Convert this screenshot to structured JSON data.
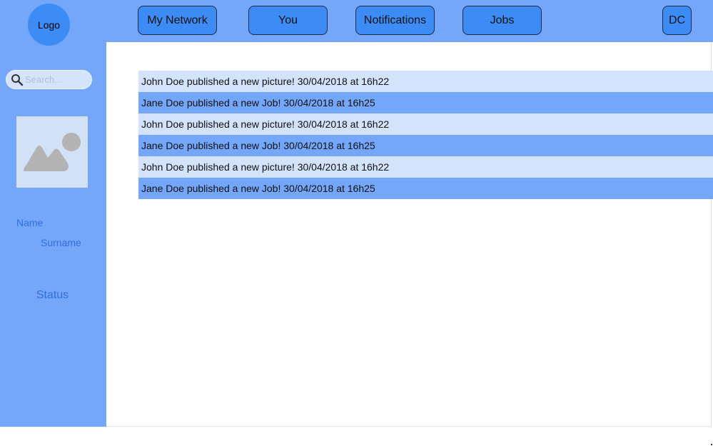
{
  "header": {
    "logo": "Logo",
    "nav": {
      "my_network": "My Network",
      "you": "You",
      "notifications": "Notifications",
      "jobs": "Jobs",
      "user_initials": "DC"
    }
  },
  "sidebar": {
    "search_placeholder": "Search...",
    "profile": {
      "name": "Name",
      "surname": "Surname",
      "status": "Status"
    }
  },
  "feed": {
    "items": [
      "John Doe published a new picture! 30/04/2018 at 16h22",
      "Jane Doe published a new Job! 30/04/2018 at 16h25",
      "John Doe published a new picture! 30/04/2018 at 16h22",
      "Jane Doe published a new Job! 30/04/2018 at 16h25",
      "John Doe published a new picture! 30/04/2018 at 16h22",
      "Jane Doe published a new Job! 30/04/2018 at 16h25"
    ]
  },
  "colors": {
    "primary_blue": "#74a6f9",
    "button_blue": "#3d8bf5",
    "light_blue": "#d3e3fb",
    "label_blue": "#2f6fe0"
  }
}
